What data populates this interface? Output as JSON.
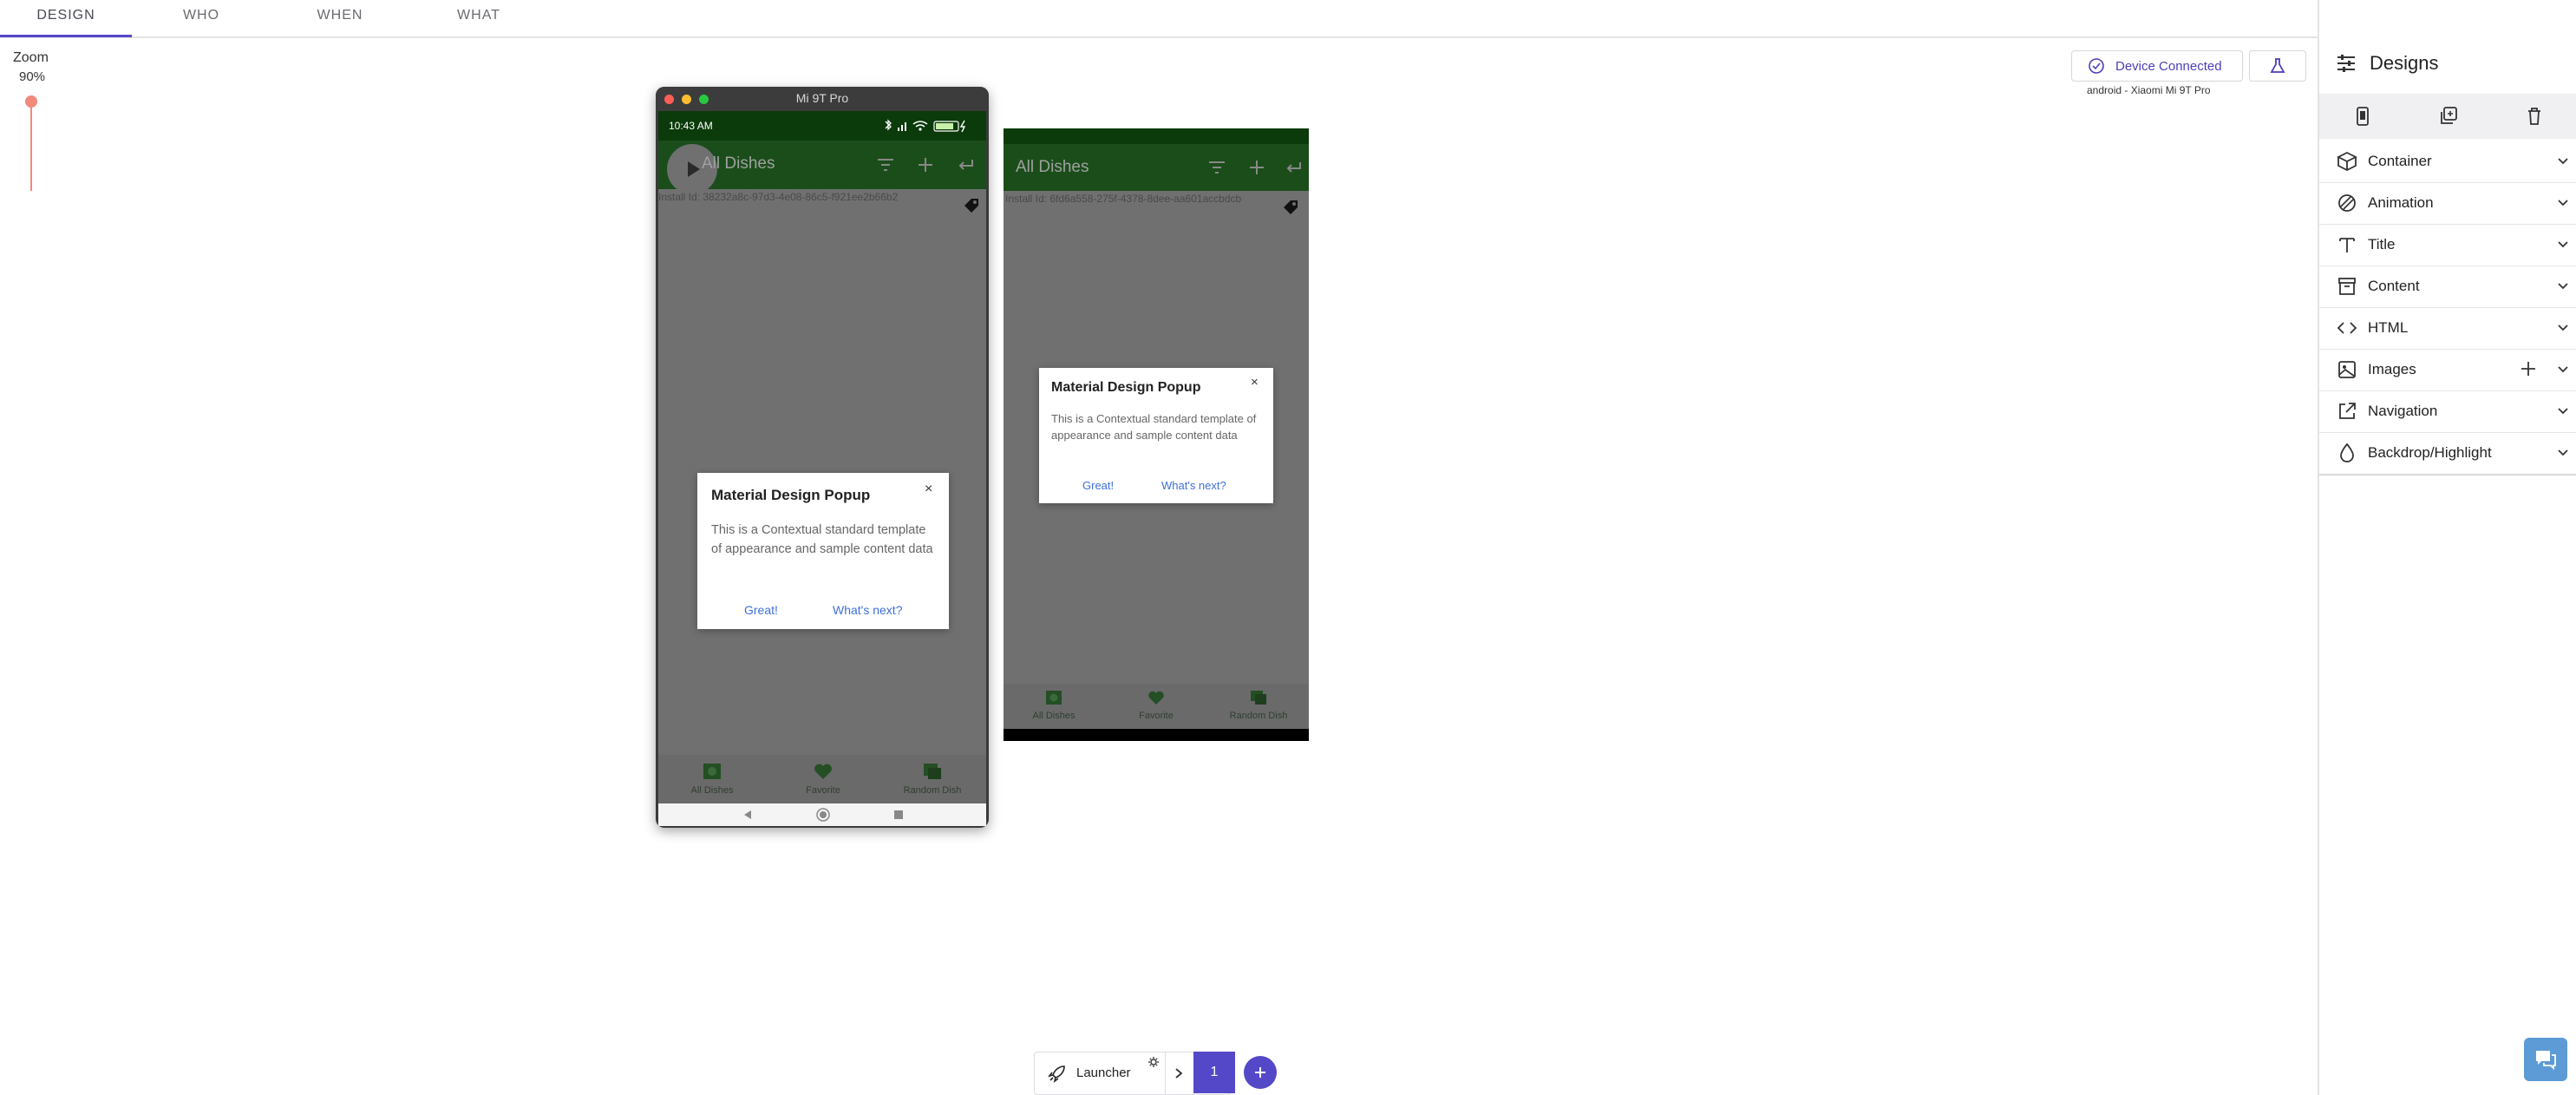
{
  "tabs": [
    {
      "label": "DESIGN",
      "active": true
    },
    {
      "label": "WHO",
      "active": false
    },
    {
      "label": "WHEN",
      "active": false
    },
    {
      "label": "WHAT",
      "active": false
    }
  ],
  "zoom": {
    "label": "Zoom",
    "value": "90%"
  },
  "device_window": {
    "title": "Mi 9T Pro",
    "status_time": "10:43 AM",
    "app_title": "All Dishes",
    "install_id": "Install Id: 38232a8c-97d3-4e08-86c5-f921ee2b66b2",
    "popup": {
      "title": "Material Design Popup",
      "close": "×",
      "body": "This is a Contextual standard template of appearance and sample content data",
      "button_primary": "Great!",
      "button_secondary": "What's next?"
    },
    "bottom_nav": [
      "All Dishes",
      "Favorite",
      "Random Dish"
    ]
  },
  "preview": {
    "app_title": "All Dishes",
    "install_id": "Install Id: 6fd6a558-275f-4378-8dee-aa601accbdcb",
    "popup": {
      "title": "Material Design Popup",
      "close": "×",
      "body": "This is a Contextual standard template of appearance and sample content data",
      "button_primary": "Great!",
      "button_secondary": "What's next?"
    },
    "bottom_nav": [
      "All Dishes",
      "Favorite",
      "Random Dish"
    ]
  },
  "device_status": {
    "label": "Device Connected",
    "info": "android - Xiaomi Mi 9T Pro"
  },
  "right_panel": {
    "title": "Designs",
    "sections": [
      "Container",
      "Animation",
      "Title",
      "Content",
      "HTML",
      "Images",
      "Navigation",
      "Backdrop/Highlight"
    ]
  },
  "launcher": {
    "label": "Launcher",
    "step": "1"
  },
  "colors": {
    "accent": "#5548c8",
    "zoom": "#f08a7c",
    "link": "#3f6fd8",
    "appbar": "#1a4d1a",
    "statusbar": "#0b3a0b"
  }
}
